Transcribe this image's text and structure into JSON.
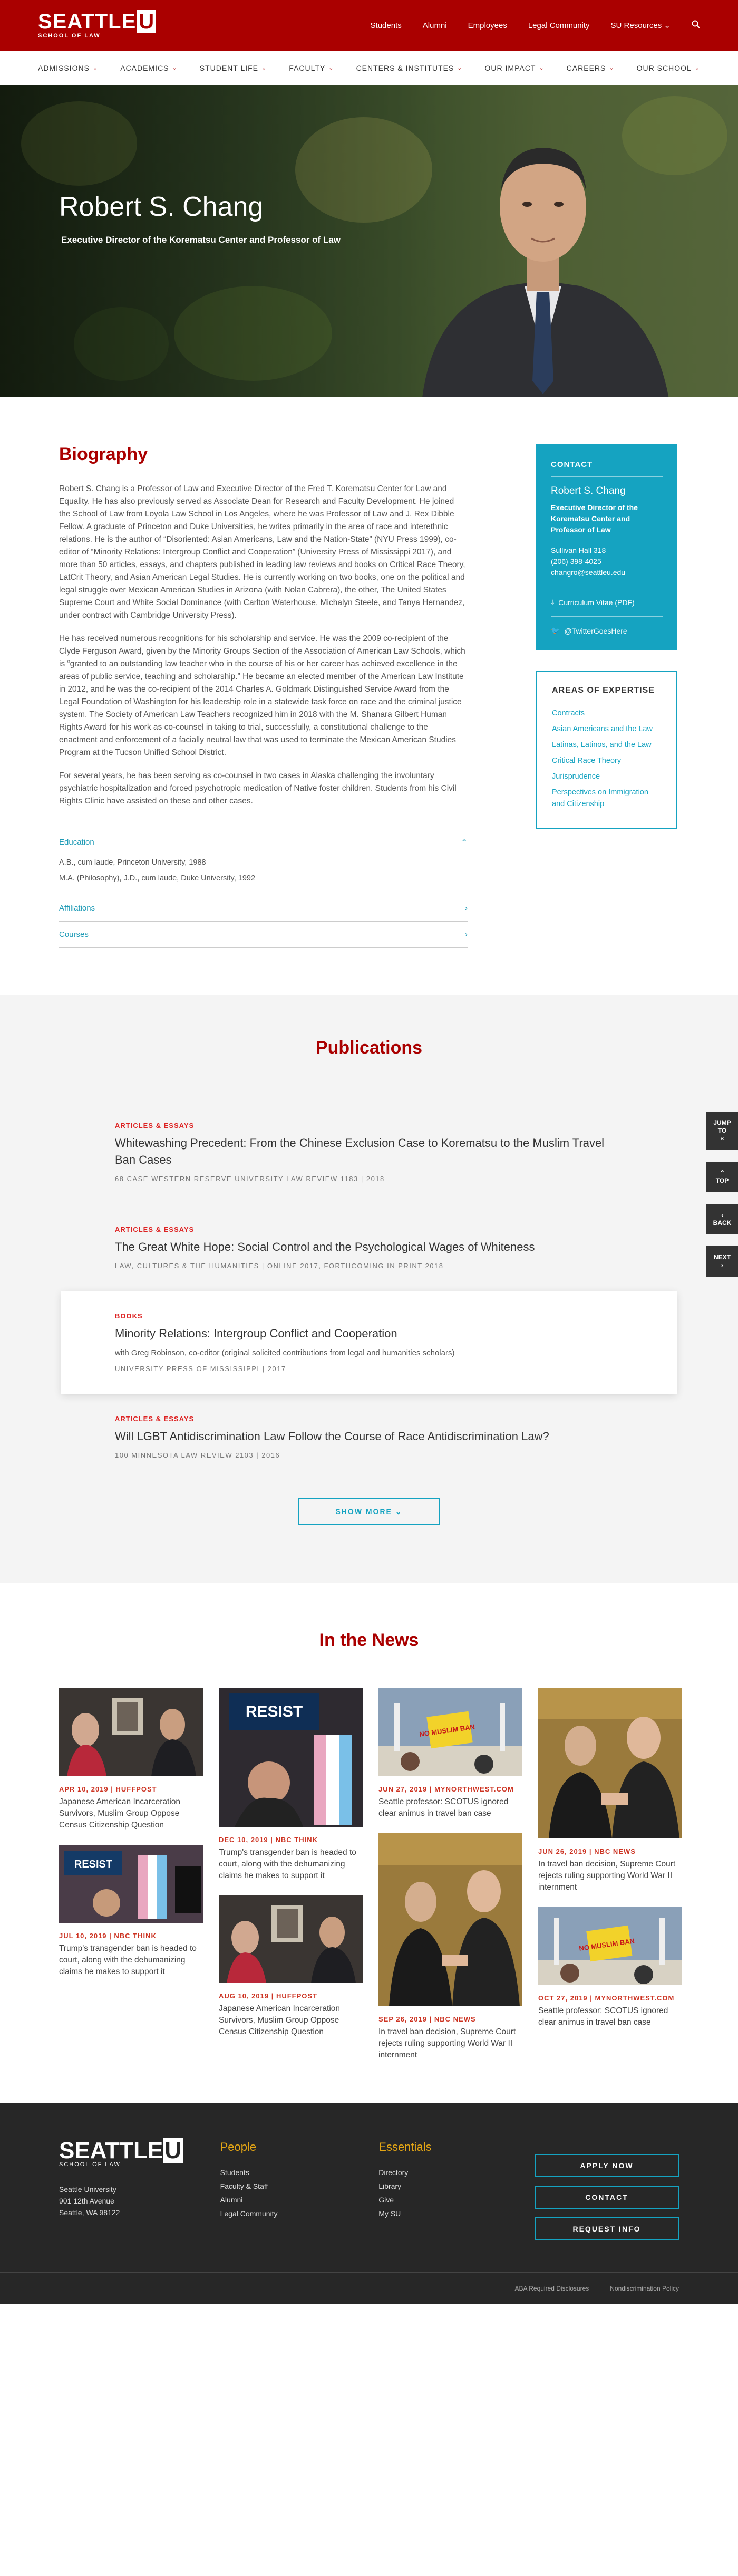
{
  "site": {
    "logo_main": "SEATTLE",
    "logo_u": "U",
    "logo_sub": "SCHOOL OF LAW"
  },
  "topnav": [
    "Students",
    "Alumni",
    "Employees",
    "Legal Community",
    "SU Resources"
  ],
  "mainnav": [
    "ADMISSIONS",
    "ACADEMICS",
    "STUDENT LIFE",
    "FACULTY",
    "CENTERS & INSTITUTES",
    "OUR IMPACT",
    "CAREERS",
    "OUR SCHOOL"
  ],
  "hero": {
    "name": "Robert S. Chang",
    "title": "Executive Director of the Korematsu Center and Professor of Law"
  },
  "biography": {
    "heading": "Biography",
    "paragraphs": [
      "Robert S. Chang is a Professor of Law and Executive Director of the Fred T. Korematsu Center for Law and Equality. He has also previously served as Associate Dean for Research and Faculty Development. He joined the School of Law from Loyola Law School in Los Angeles, where he was Professor of Law and J. Rex Dibble Fellow. A graduate of Princeton and Duke Universities, he writes primarily in the area of race and interethnic relations. He is the author of “Disoriented: Asian Americans, Law and the Nation-State” (NYU Press 1999), co-editor of “Minority Relations: Intergroup Conflict and Cooperation” (University Press of Mississippi 2017), and more than 50 articles, essays, and chapters published in leading law reviews and books on Critical Race Theory, LatCrit Theory, and Asian American Legal Studies. He is currently working on two books, one on the political and legal struggle over Mexican American Studies in Arizona (with Nolan Cabrera), the other, The United States Supreme Court and White Social Dominance (with Carlton Waterhouse, Michalyn Steele, and Tanya Hernandez, under contract with Cambridge University Press).",
      "He has received numerous recognitions for his scholarship and service. He was the 2009 co-recipient of the Clyde Ferguson Award, given by the Minority Groups Section of the Association of American Law Schools, which is “granted to an outstanding law teacher who in the course of his or her career has achieved excellence in the areas of public service, teaching and scholarship.” He became an elected member of the American Law Institute in 2012, and he was the co-recipient of the 2014 Charles A. Goldmark Distinguished Service Award from the Legal Foundation of Washington for his leadership role in a statewide task force on race and the criminal justice system. The Society of American Law Teachers recognized him in 2018 with the M. Shanara Gilbert Human Rights Award for his work as co-counsel in taking to trial, successfully, a constitutional challenge to the enactment and enforcement of a facially neutral law that was used to terminate the Mexican American Studies Program at the Tucson Unified School District.",
      "For several years, he has been serving as co-counsel in two cases in Alaska challenging the involuntary psychiatric hospitalization and forced psychotropic medication of Native foster children. Students from his Civil Rights Clinic have assisted on these and other cases."
    ]
  },
  "accordion": {
    "education_label": "Education",
    "education_items": [
      "A.B., cum laude, Princeton University, 1988",
      "M.A. (Philosophy), J.D., cum laude, Duke University, 1992"
    ],
    "affiliations_label": "Affiliations",
    "courses_label": "Courses"
  },
  "contact": {
    "heading": "CONTACT",
    "name": "Robert S. Chang",
    "title": "Executive Director of the Korematsu Center and Professor of Law",
    "office": "Sullivan Hall 318",
    "phone": "(206) 398-4025",
    "email": "changro@seattleu.edu",
    "cv": "Curriculum Vitae (PDF)",
    "twitter": "@TwitterGoesHere"
  },
  "expertise": {
    "heading": "AREAS OF EXPERTISE",
    "items": [
      "Contracts",
      "Asian Americans and the Law",
      "Latinas, Latinos, and the Law",
      "Critical Race Theory",
      "Jurisprudence",
      "Perspectives on Immigration and Citizenship"
    ]
  },
  "publications": {
    "heading": "Publications",
    "items": [
      {
        "category": "ARTICLES & ESSAYS",
        "title": "Whitewashing Precedent: From the Chinese Exclusion Case to Korematsu to the Muslim Travel Ban Cases",
        "meta": "68 CASE WESTERN RESERVE UNIVERSITY LAW REVIEW 1183  |  2018"
      },
      {
        "category": "ARTICLES & ESSAYS",
        "title": "The Great White Hope: Social Control and the Psychological Wages of Whiteness",
        "meta": "LAW, CULTURES & THE HUMANITIES  |  ONLINE 2017, FORTHCOMING IN PRINT 2018"
      },
      {
        "category": "BOOKS",
        "title": "Minority Relations: Intergroup Conflict and Cooperation",
        "with": "with Greg Robinson, co-editor (original solicited contributions from legal and humanities scholars)",
        "meta": "UNIVERSITY PRESS OF MISSISSIPPI  |  2017"
      },
      {
        "category": "ARTICLES & ESSAYS",
        "title": "Will LGBT Antidiscrimination Law Follow the Course of Race Antidiscrimination Law?",
        "meta": "100 MINNESOTA LAW REVIEW 2103  |  2016"
      }
    ],
    "show_more": "SHOW MORE"
  },
  "sidenav": {
    "jump": "JUMP TO",
    "top": "TOP",
    "back": "BACK",
    "next": "NEXT"
  },
  "news": {
    "heading": "In the News",
    "items": [
      {
        "date": "APR 10, 2019  |  HUFFPOST",
        "text": "Japanese American Incarceration Survivors, Muslim Group Oppose Census Citizenship Question"
      },
      {
        "date": "JUL 10, 2019  |  NBC THINK",
        "text": "Trump's transgender ban is headed to court, along with the dehumanizing claims he makes to support it"
      },
      {
        "date": "DEC 10, 2019  |  NBC THINK",
        "text": "Trump's transgender ban is headed to court, along with the dehumanizing claims he makes to support it"
      },
      {
        "date": "AUG 10, 2019  |  HUFFPOST",
        "text": "Japanese American Incarceration Survivors, Muslim Group Oppose Census Citizenship Question"
      },
      {
        "date": "JUN 27, 2019  |  MYNORTHWEST.COM",
        "text": "Seattle professor: SCOTUS ignored clear animus in travel ban case"
      },
      {
        "date": "SEP 26, 2019  |  NBC NEWS",
        "text": "In travel ban decision, Supreme Court rejects ruling supporting World War II internment"
      },
      {
        "date": "JUN 26, 2019  |  NBC NEWS",
        "text": "In travel ban decision, Supreme Court rejects ruling supporting World War II internment"
      },
      {
        "date": "OCT 27, 2019  |  MYNORTHWEST.COM",
        "text": "Seattle professor: SCOTUS ignored clear animus in travel ban case"
      }
    ],
    "resist_sign": "RESIST",
    "nomuslim_sign": "NO MUSLIM BAN"
  },
  "footer": {
    "address": [
      "Seattle University",
      "901 12th Avenue",
      "Seattle, WA 98122"
    ],
    "people_heading": "People",
    "people_links": [
      "Students",
      "Faculty & Staff",
      "Alumni",
      "Legal Community"
    ],
    "essentials_heading": "Essentials",
    "essentials_links": [
      "Directory",
      "Library",
      "Give",
      "My SU"
    ],
    "buttons": [
      "APPLY NOW",
      "CONTACT",
      "REQUEST INFO"
    ],
    "bottom_links": [
      "ABA Required Disclosures",
      "Nondiscrimination Policy"
    ]
  }
}
